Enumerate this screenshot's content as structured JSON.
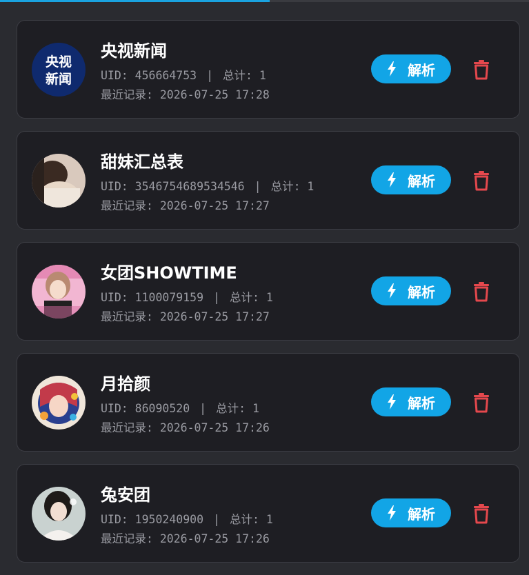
{
  "progress": 0.51,
  "accent_color": "#12a5e6",
  "delete_color": "#e5484d",
  "entries": [
    {
      "name": "央视新闻",
      "uid": "UID: 456664753",
      "total": "总计: 1",
      "recent": "最近记录: 2026-07-25 17:28",
      "parse_label": "解析",
      "parse_icon": "lightning-icon",
      "delete_icon": "trash-icon",
      "avatar_text_1": "央视",
      "avatar_text_2": "新闻"
    },
    {
      "name": "甜妹汇总表",
      "uid": "UID: 3546754689534546",
      "total": "总计: 1",
      "recent": "最近记录: 2026-07-25 17:27",
      "parse_label": "解析",
      "parse_icon": "lightning-icon",
      "delete_icon": "trash-icon"
    },
    {
      "name": "女团SHOWTIME",
      "uid": "UID: 1100079159",
      "total": "总计: 1",
      "recent": "最近记录: 2026-07-25 17:27",
      "parse_label": "解析",
      "parse_icon": "lightning-icon",
      "delete_icon": "trash-icon"
    },
    {
      "name": "月拾颜",
      "uid": "UID: 86090520",
      "total": "总计: 1",
      "recent": "最近记录: 2026-07-25 17:26",
      "parse_label": "解析",
      "parse_icon": "lightning-icon",
      "delete_icon": "trash-icon"
    },
    {
      "name": "兔安团",
      "uid": "UID: 1950240900",
      "total": "总计: 1",
      "recent": "最近记录: 2026-07-25 17:26",
      "parse_label": "解析",
      "parse_icon": "lightning-icon",
      "delete_icon": "trash-icon"
    }
  ]
}
